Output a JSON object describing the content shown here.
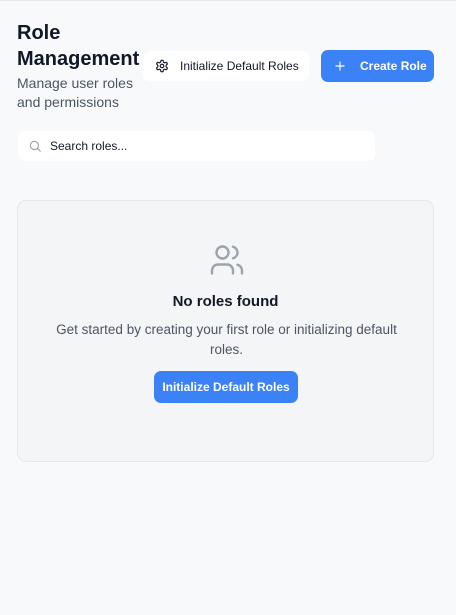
{
  "header": {
    "title": "Role Management",
    "subtitle": "Manage user roles and permissions"
  },
  "toolbar": {
    "init_default_label": "Initialize Default Roles",
    "init_default_icon": "gear-icon",
    "create_role_label": "Create Role",
    "create_role_icon": "plus-icon"
  },
  "search": {
    "placeholder": "Search roles...",
    "value": "",
    "icon": "search-icon"
  },
  "empty_state": {
    "icon": "users-icon",
    "title": "No roles found",
    "description": "Get started by creating your first role or initializing default roles.",
    "button_label": "Initialize Default Roles"
  },
  "colors": {
    "accent": "#3b82f6",
    "background": "#f8f9fb",
    "card": "#f4f5f7"
  }
}
